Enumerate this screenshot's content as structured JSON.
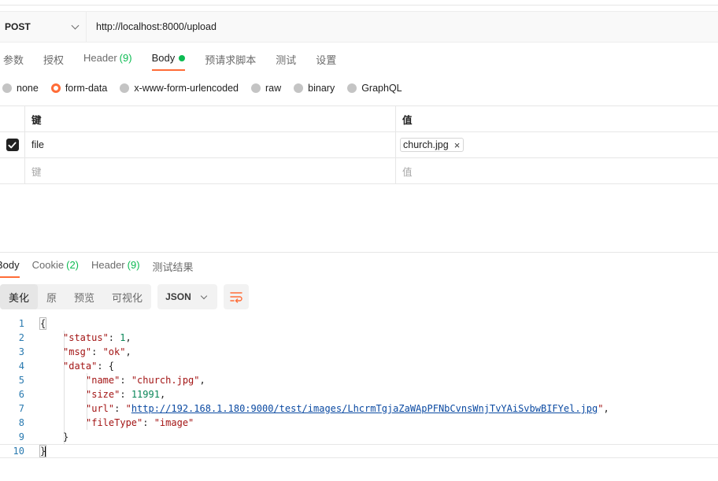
{
  "request": {
    "method": "POST",
    "url": "http://localhost:8000/upload"
  },
  "request_tabs": [
    {
      "label": "参数"
    },
    {
      "label": "授权"
    },
    {
      "label": "Header",
      "count": "(9)"
    },
    {
      "label": "Body",
      "active": true,
      "indicator": "dot"
    },
    {
      "label": "预请求脚本"
    },
    {
      "label": "测试"
    },
    {
      "label": "设置"
    }
  ],
  "body_types": [
    {
      "label": "none"
    },
    {
      "label": "form-data",
      "selected": true
    },
    {
      "label": "x-www-form-urlencoded"
    },
    {
      "label": "raw"
    },
    {
      "label": "binary"
    },
    {
      "label": "GraphQL"
    }
  ],
  "kv_table": {
    "key_header": "键",
    "value_header": "值",
    "rows": [
      {
        "checked": true,
        "key": "file",
        "value": "church.jpg",
        "remove_icon": "×"
      }
    ],
    "placeholder_key": "键",
    "placeholder_value": "值"
  },
  "response_tabs": [
    {
      "label": "Body",
      "active": true
    },
    {
      "label": "Cookie",
      "count": "(2)"
    },
    {
      "label": "Header",
      "count": "(9)"
    },
    {
      "label": "测试结果"
    }
  ],
  "view_modes": [
    "美化",
    "原",
    "预览",
    "可视化"
  ],
  "format": "JSON",
  "code_lines": [
    {
      "n": "1",
      "parts": [
        {
          "t": "{",
          "c": "p"
        }
      ]
    },
    {
      "n": "2",
      "indent": 4,
      "parts": [
        {
          "t": "\"status\"",
          "c": "k"
        },
        {
          "t": ": ",
          "c": "p"
        },
        {
          "t": "1",
          "c": "n"
        },
        {
          "t": ",",
          "c": "p"
        }
      ]
    },
    {
      "n": "3",
      "indent": 4,
      "parts": [
        {
          "t": "\"msg\"",
          "c": "k"
        },
        {
          "t": ": ",
          "c": "p"
        },
        {
          "t": "\"ok\"",
          "c": "s"
        },
        {
          "t": ",",
          "c": "p"
        }
      ]
    },
    {
      "n": "4",
      "indent": 4,
      "parts": [
        {
          "t": "\"data\"",
          "c": "k"
        },
        {
          "t": ": {",
          "c": "p"
        }
      ]
    },
    {
      "n": "5",
      "indent": 8,
      "parts": [
        {
          "t": "\"name\"",
          "c": "k"
        },
        {
          "t": ": ",
          "c": "p"
        },
        {
          "t": "\"church.jpg\"",
          "c": "s"
        },
        {
          "t": ",",
          "c": "p"
        }
      ]
    },
    {
      "n": "6",
      "indent": 8,
      "parts": [
        {
          "t": "\"size\"",
          "c": "k"
        },
        {
          "t": ": ",
          "c": "p"
        },
        {
          "t": "11991",
          "c": "n"
        },
        {
          "t": ",",
          "c": "p"
        }
      ]
    },
    {
      "n": "7",
      "indent": 8,
      "parts": [
        {
          "t": "\"url\"",
          "c": "k"
        },
        {
          "t": ": ",
          "c": "p"
        },
        {
          "t": "\"",
          "c": "s"
        },
        {
          "t": "http://192.168.1.180:9000/test/images/LhcrmTgjaZaWApPFNbCvnsWnjTvYAiSvbwBIFYel.jpg",
          "c": "lnk"
        },
        {
          "t": "\"",
          "c": "s"
        },
        {
          "t": ",",
          "c": "p"
        }
      ]
    },
    {
      "n": "8",
      "indent": 8,
      "parts": [
        {
          "t": "\"fileType\"",
          "c": "k"
        },
        {
          "t": ": ",
          "c": "p"
        },
        {
          "t": "\"image\"",
          "c": "s"
        }
      ]
    },
    {
      "n": "9",
      "indent": 4,
      "parts": [
        {
          "t": "}",
          "c": "p"
        }
      ]
    },
    {
      "n": "10",
      "parts": [
        {
          "t": "}",
          "c": "p"
        }
      ]
    }
  ],
  "colors": {
    "accent": "#ff6c37",
    "count_green": "#0cbb52",
    "json_key": "#a31515",
    "json_number": "#098658",
    "json_link": "#0b4aa2",
    "line_number": "#2a7ab0"
  },
  "icons": {
    "method_dropdown": "chevron-down-icon",
    "checkbox": "check-icon",
    "file_remove": "close-icon",
    "format_dropdown": "chevron-down-icon",
    "wrap": "text-wrap-icon"
  }
}
